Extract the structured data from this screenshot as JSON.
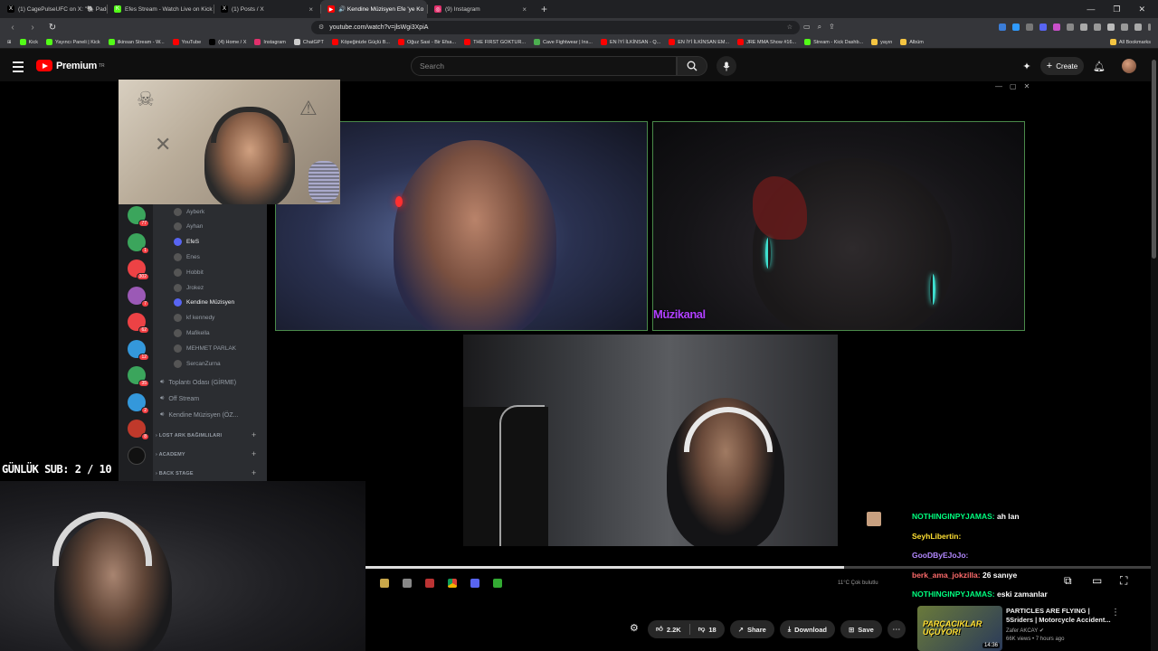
{
  "browser": {
    "tabs": [
      {
        "label": "(1) CagePulseUFC on X: \"🐘 Paddy P...",
        "color": "#000000",
        "glyph": "X",
        "active": false
      },
      {
        "label": "Efes Stream - Watch Live on Kick",
        "color": "#53fc18",
        "glyph": "K",
        "active": false
      },
      {
        "label": "(1) Posts / X",
        "color": "#000000",
        "glyph": "X",
        "active": false
      },
      {
        "label": "🔊 Kendine Müzisyen Efe 'ye Ko",
        "color": "#ff0000",
        "glyph": "▶",
        "active": true
      },
      {
        "label": "(9) Instagram",
        "color": "#e1306c",
        "glyph": "◎",
        "active": false
      }
    ],
    "new_tab": "+",
    "url": "youtube.com/watch?v=jlsWgi3XpiA",
    "bookmarks": [
      {
        "label": "Kick",
        "color": "#53fc18"
      },
      {
        "label": "Yayıncı Paneli | Kick",
        "color": "#53fc18"
      },
      {
        "label": "ilkinsan Stream - W...",
        "color": "#53fc18"
      },
      {
        "label": "YouTube",
        "color": "#ff0000"
      },
      {
        "label": "(4) Home / X",
        "color": "#000000"
      },
      {
        "label": "Instagram",
        "color": "#e1306c"
      },
      {
        "label": "ChatGPT",
        "color": "#cccccc"
      },
      {
        "label": "Köpeğinizle Güçlü B...",
        "color": "#ff0000"
      },
      {
        "label": "Oğuz Sasi - Bir Efsa...",
        "color": "#ff0000"
      },
      {
        "label": "THE FIRST GOKTUR...",
        "color": "#ff0000"
      },
      {
        "label": "Cave Fightwear | Ins...",
        "color": "#4caf50"
      },
      {
        "label": "EN İYİ İLKİNSAN - Q...",
        "color": "#ff0000"
      },
      {
        "label": "EN İYİ İLKİNSAN EM...",
        "color": "#ff0000"
      },
      {
        "label": "JRE MMA Show #16...",
        "color": "#ff0000"
      },
      {
        "label": "Stream - Kick Dashb...",
        "color": "#53fc18"
      },
      {
        "label": "yayın",
        "color": "#f5c542"
      },
      {
        "label": "Albüm",
        "color": "#f5c542"
      }
    ],
    "all_bookmarks": "All Bookmarks"
  },
  "youtube": {
    "logo_text": "Premium",
    "logo_sup": "TR",
    "search_placeholder": "Search",
    "create_label": "Create",
    "accent": "#ff0000"
  },
  "discord": {
    "members": [
      {
        "name": "Ayberk",
        "active": false
      },
      {
        "name": "Ayhan",
        "active": false
      },
      {
        "name": "EfeS",
        "active": true
      },
      {
        "name": "Enes",
        "active": false
      },
      {
        "name": "Hobbit",
        "active": false
      },
      {
        "name": "Jrokez",
        "active": false
      },
      {
        "name": "Kendine Müzisyen",
        "active": true
      },
      {
        "name": "kf kennedy",
        "active": false
      },
      {
        "name": "Mafikella",
        "active": false
      },
      {
        "name": "MEHMET PARLAK",
        "active": false
      },
      {
        "name": "SercanZurna",
        "active": false
      }
    ],
    "channels": [
      "Toplantı Odası (GİRME)",
      "Off Stream",
      "Kendine Müzisyen (ÖZ..."
    ],
    "categories": [
      "LOST ARK BAĞIMLILARI",
      "ACADEMY",
      "BACK STAGE"
    ],
    "guild_badges": [
      "77",
      "1",
      "302",
      "7",
      "62",
      "12",
      "35",
      "2",
      "8"
    ]
  },
  "overlay": {
    "sub_goal": "GÜNLÜK SUB: 2 / 10",
    "cam_label": "Müzikanal"
  },
  "chat": [
    {
      "user": "NOTHINGINPYJAMAS:",
      "msg": "ah lan",
      "color": "#00ff7f"
    },
    {
      "user": "SeyhLibertin:",
      "msg": "",
      "color": "#ffe033"
    },
    {
      "user": "GooDByEJoJo:",
      "msg": "",
      "color": "#b388ff"
    },
    {
      "user": "berk_ama_jokzilla:",
      "msg": "26 sanıye",
      "color": "#ff6b6b"
    },
    {
      "user": "NOTHINGINPYJAMAS:",
      "msg": "eski zamanlar",
      "color": "#00ff7f"
    }
  ],
  "player": {
    "progress": 0.61,
    "weather": "11°C  Çok bulutlu"
  },
  "actions": {
    "likes": "2.2K",
    "dislikes": "18",
    "share": "Share",
    "download": "Download",
    "save": "Save"
  },
  "recommendation": {
    "title": "PARTICLES ARE FLYING | 5Sriders | Motorcycle Accident...",
    "channel": "Zafer AKCAY",
    "meta": "66K views • 7 hours ago",
    "duration": "14:36",
    "thumb_text": "PARÇACIKLAR UÇUYOR!"
  }
}
